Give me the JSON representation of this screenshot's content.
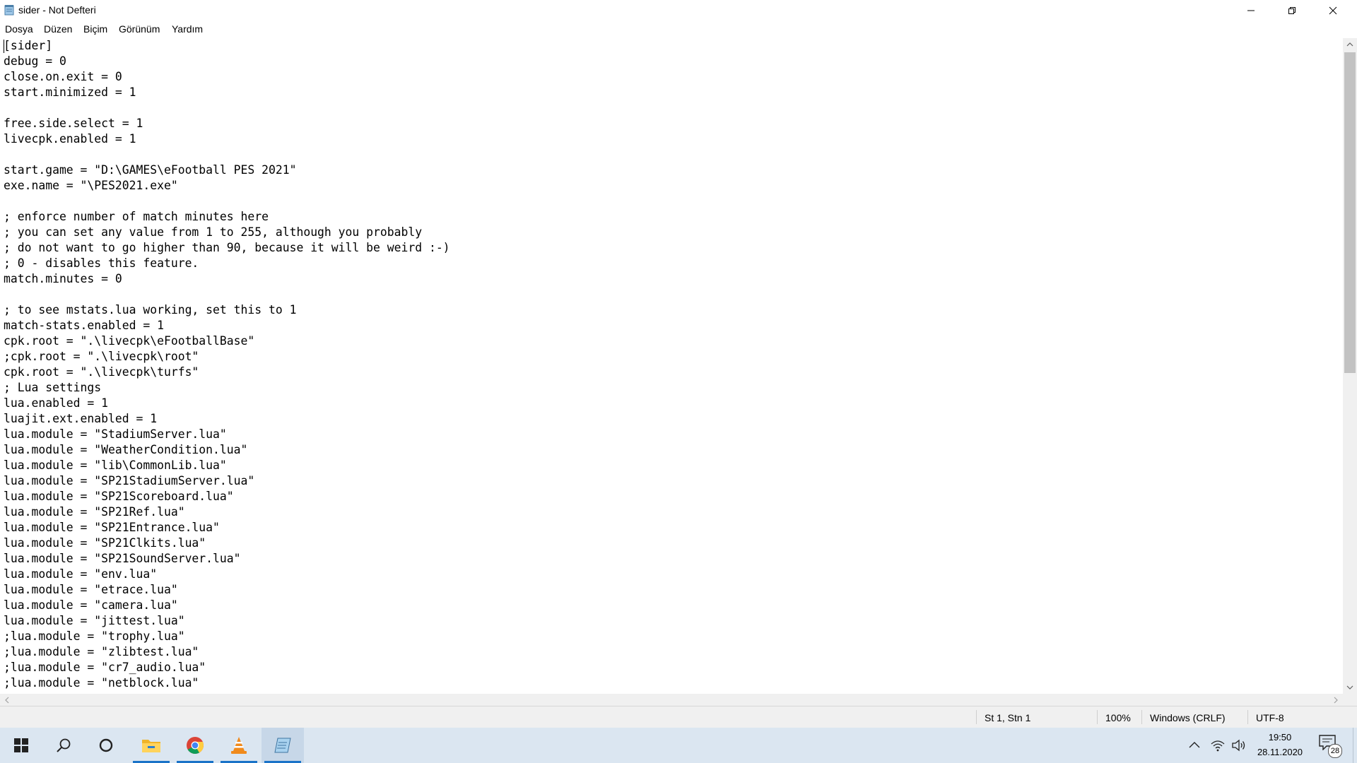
{
  "window": {
    "title": "sider - Not Defteri"
  },
  "menu": [
    "Dosya",
    "Düzen",
    "Biçim",
    "Görünüm",
    "Yardım"
  ],
  "editor": {
    "content": "[sider]\ndebug = 0\nclose.on.exit = 0\nstart.minimized = 1\n\nfree.side.select = 1\nlivecpk.enabled = 1\n\nstart.game = \"D:\\GAMES\\eFootball PES 2021\"\nexe.name = \"\\PES2021.exe\"\n\n; enforce number of match minutes here\n; you can set any value from 1 to 255, although you probably\n; do not want to go higher than 90, because it will be weird :-)\n; 0 - disables this feature.\nmatch.minutes = 0\n\n; to see mstats.lua working, set this to 1\nmatch-stats.enabled = 1\ncpk.root = \".\\livecpk\\eFootballBase\"\n;cpk.root = \".\\livecpk\\root\"\ncpk.root = \".\\livecpk\\turfs\"\n; Lua settings\nlua.enabled = 1\nluajit.ext.enabled = 1\nlua.module = \"StadiumServer.lua\"\nlua.module = \"WeatherCondition.lua\"\nlua.module = \"lib\\CommonLib.lua\"\nlua.module = \"SP21StadiumServer.lua\"\nlua.module = \"SP21Scoreboard.lua\"\nlua.module = \"SP21Ref.lua\"\nlua.module = \"SP21Entrance.lua\"\nlua.module = \"SP21Clkits.lua\"\nlua.module = \"SP21SoundServer.lua\"\nlua.module = \"env.lua\"\nlua.module = \"etrace.lua\"\nlua.module = \"camera.lua\"\nlua.module = \"jittest.lua\"\n;lua.module = \"trophy.lua\"\n;lua.module = \"zlibtest.lua\"\n;lua.module = \"cr7_audio.lua\"\n;lua.module = \"netblock.lua\""
  },
  "statusbar": {
    "position": "St 1, Stn 1",
    "zoom": "100%",
    "line_ending": "Windows (CRLF)",
    "encoding": "UTF-8"
  },
  "taskbar": {
    "apps": [
      "start-icon",
      "search-icon",
      "cortana-icon",
      "file-explorer-icon",
      "chrome-icon",
      "vlc-icon",
      "notepad-icon"
    ],
    "clock_time": "19:50",
    "clock_date": "28.11.2020",
    "notification_count": "28",
    "accent": "#1a73c8"
  }
}
